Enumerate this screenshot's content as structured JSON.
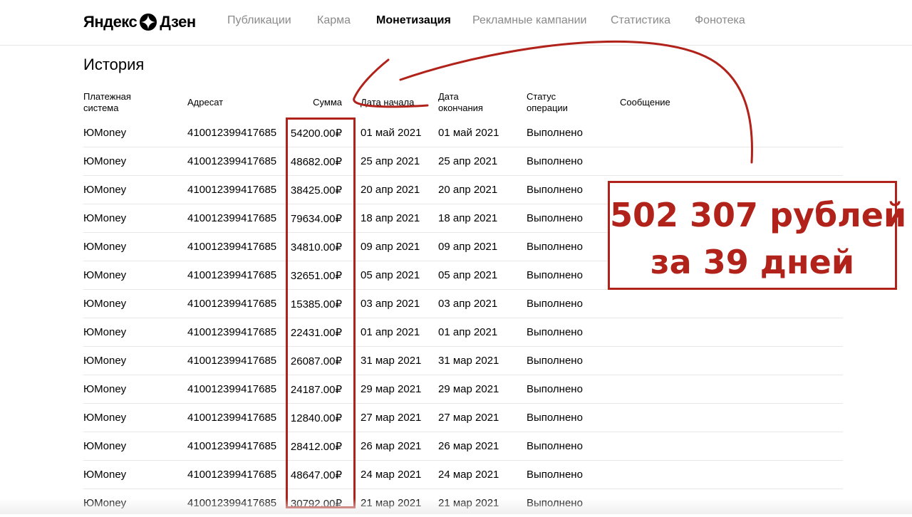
{
  "header": {
    "logo_part1": "Яндекс",
    "logo_part2": "Дзен",
    "nav": [
      {
        "label": "Публикации",
        "active": false
      },
      {
        "label": "Карма",
        "active": false
      },
      {
        "label": "Монетизация",
        "active": true
      },
      {
        "label": "Рекламные кампании",
        "active": false
      },
      {
        "label": "Статистика",
        "active": false
      },
      {
        "label": "Фонотека",
        "active": false
      }
    ]
  },
  "main": {
    "title": "История",
    "columns": {
      "system": "Платежная система",
      "recipient": "Адресат",
      "amount": "Сумма",
      "start_date": "Дата начала",
      "end_date": "Дата окончания",
      "status": "Статус операции",
      "message": "Сообщение"
    },
    "rows": [
      {
        "system": "ЮMoney",
        "recipient": "410012399417685",
        "amount": "54200.00₽",
        "start": "01 май 2021",
        "end": "01 май 2021",
        "status": "Выполнено"
      },
      {
        "system": "ЮMoney",
        "recipient": "410012399417685",
        "amount": "48682.00₽",
        "start": "25 апр 2021",
        "end": "25 апр 2021",
        "status": "Выполнено"
      },
      {
        "system": "ЮMoney",
        "recipient": "410012399417685",
        "amount": "38425.00₽",
        "start": "20 апр 2021",
        "end": "20 апр 2021",
        "status": "Выполнено"
      },
      {
        "system": "ЮMoney",
        "recipient": "410012399417685",
        "amount": "79634.00₽",
        "start": "18 апр 2021",
        "end": "18 апр 2021",
        "status": "Выполнено"
      },
      {
        "system": "ЮMoney",
        "recipient": "410012399417685",
        "amount": "34810.00₽",
        "start": "09 апр 2021",
        "end": "09 апр 2021",
        "status": "Выполнено"
      },
      {
        "system": "ЮMoney",
        "recipient": "410012399417685",
        "amount": "32651.00₽",
        "start": "05 апр 2021",
        "end": "05 апр 2021",
        "status": "Выполнено"
      },
      {
        "system": "ЮMoney",
        "recipient": "410012399417685",
        "amount": "15385.00₽",
        "start": "03 апр 2021",
        "end": "03 апр 2021",
        "status": "Выполнено"
      },
      {
        "system": "ЮMoney",
        "recipient": "410012399417685",
        "amount": "22431.00₽",
        "start": "01 апр 2021",
        "end": "01 апр 2021",
        "status": "Выполнено"
      },
      {
        "system": "ЮMoney",
        "recipient": "410012399417685",
        "amount": "26087.00₽",
        "start": "31 мар 2021",
        "end": "31 мар 2021",
        "status": "Выполнено"
      },
      {
        "system": "ЮMoney",
        "recipient": "410012399417685",
        "amount": "24187.00₽",
        "start": "29 мар 2021",
        "end": "29 мар 2021",
        "status": "Выполнено"
      },
      {
        "system": "ЮMoney",
        "recipient": "410012399417685",
        "amount": "12840.00₽",
        "start": "27 мар 2021",
        "end": "27 мар 2021",
        "status": "Выполнено"
      },
      {
        "system": "ЮMoney",
        "recipient": "410012399417685",
        "amount": "28412.00₽",
        "start": "26 мар 2021",
        "end": "26 мар 2021",
        "status": "Выполнено"
      },
      {
        "system": "ЮMoney",
        "recipient": "410012399417685",
        "amount": "48647.00₽",
        "start": "24 мар 2021",
        "end": "24 мар 2021",
        "status": "Выполнено"
      },
      {
        "system": "ЮMoney",
        "recipient": "410012399417685",
        "amount": "30792.00₽",
        "start": "21 мар 2021",
        "end": "21 мар 2021",
        "status": "Выполнено"
      }
    ]
  },
  "annotation": {
    "line1": "502 307 рублей",
    "line2": "за 39 дней",
    "color": "#b0221a"
  },
  "colors": {
    "nav_inactive": "#8a8a8a",
    "row_divider": "#e8e8e8"
  }
}
